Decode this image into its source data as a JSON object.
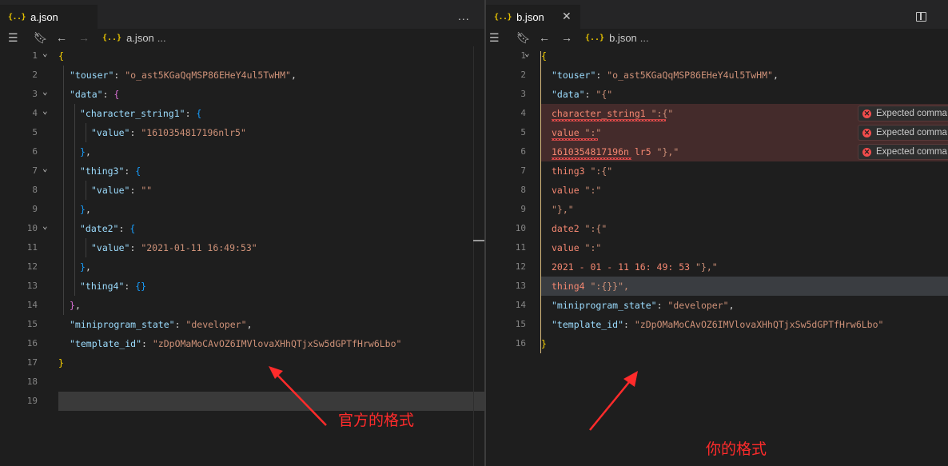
{
  "left": {
    "tab": {
      "icon": "{..}",
      "name": "a.json"
    },
    "more": "...",
    "breadcrumb": {
      "icon": "{..}",
      "file": "a.json",
      "ellipsis": "..."
    },
    "line_numbers": [
      "1",
      "2",
      "3",
      "4",
      "5",
      "6",
      "7",
      "8",
      "9",
      "10",
      "11",
      "12",
      "13",
      "14",
      "15",
      "16",
      "17",
      "18",
      "19"
    ],
    "lines": {
      "l1_open": "{",
      "l2_key": "\"touser\"",
      "l2_val": "\"o_ast5KGaQqMSP86EHeY4ul5TwHM\"",
      "l3_key": "\"data\"",
      "l3_open": "{",
      "l4_key": "\"character_string1\"",
      "l4_open": "{",
      "l5_key": "\"value\"",
      "l5_val": "\"1610354817196nlr5\"",
      "l6_close": "}",
      "l7_key": "\"thing3\"",
      "l7_open": "{",
      "l8_key": "\"value\"",
      "l8_val": "\"\"",
      "l9_close": "}",
      "l10_key": "\"date2\"",
      "l10_open": "{",
      "l11_key": "\"value\"",
      "l11_val": "\"2021-01-11 16:49:53\"",
      "l12_close": "}",
      "l13_key": "\"thing4\"",
      "l13_val": "{}",
      "l14_close": "}",
      "l15_key": "\"miniprogram_state\"",
      "l15_val": "\"developer\"",
      "l16_key": "\"template_id\"",
      "l16_val": "\"zDpOMaMoCAvOZ6IMVlovaXHhQTjxSw5dGPTfHrw6Lbo\"",
      "l17_close": "}"
    },
    "annotation": "官方的格式"
  },
  "right": {
    "tab": {
      "icon": "{..}",
      "name": "b.json",
      "close": "✕"
    },
    "breadcrumb": {
      "icon": "{..}",
      "file": "b.json",
      "ellipsis": "..."
    },
    "line_numbers": [
      "1",
      "2",
      "3",
      "4",
      "5",
      "6",
      "7",
      "8",
      "9",
      "10",
      "11",
      "12",
      "13",
      "14",
      "15",
      "16"
    ],
    "lines": {
      "l1_open": "{",
      "l2_key": "\"touser\"",
      "l2_val": "\"o_ast5KGaQqMSP86EHeY4ul5TwHM\"",
      "l3_key": "\"data\"",
      "l3_val": "\"{\"",
      "l4_text": "character_string1",
      "l4_rest": " \":{\"",
      "l5_text": "value",
      "l5_rest": " \":\"",
      "l6_text": "1610354817196n lr5",
      "l6_rest": " \"},\"",
      "l7_text": "thing3",
      "l7_rest": " \":{\"",
      "l8_text": "value",
      "l8_rest": " \":\"",
      "l9_text": "\"},\"",
      "l10_text": "date2",
      "l10_rest": " \":{\"",
      "l11_text": "value",
      "l11_rest": " \":\"",
      "l12_text": "2021 - 01 - 11 16: 49: 53",
      "l12_rest": " \"},\"",
      "l13_text": "thing4",
      "l13_rest": " \":{}}\",",
      "l14_key": "\"miniprogram_state\"",
      "l14_val": "\"developer\"",
      "l15_key": "\"template_id\"",
      "l15_val": "\"zDpOMaMoCAvOZ6IMVlovaXHhQTjxSw5dGPTfHrw6Lbo\"",
      "l16_close": "}"
    },
    "errors": [
      "Expected comma",
      "Expected comma",
      "Expected comma"
    ],
    "annotation": "你的格式"
  },
  "colors": {
    "key": "#9cdcfe",
    "string": "#ce9178",
    "bracket_gold": "#ffd700",
    "bracket_purple": "#da70d6",
    "bracket_blue": "#179fff",
    "error": "#f14c4c",
    "annotation": "#ff2b2b"
  }
}
